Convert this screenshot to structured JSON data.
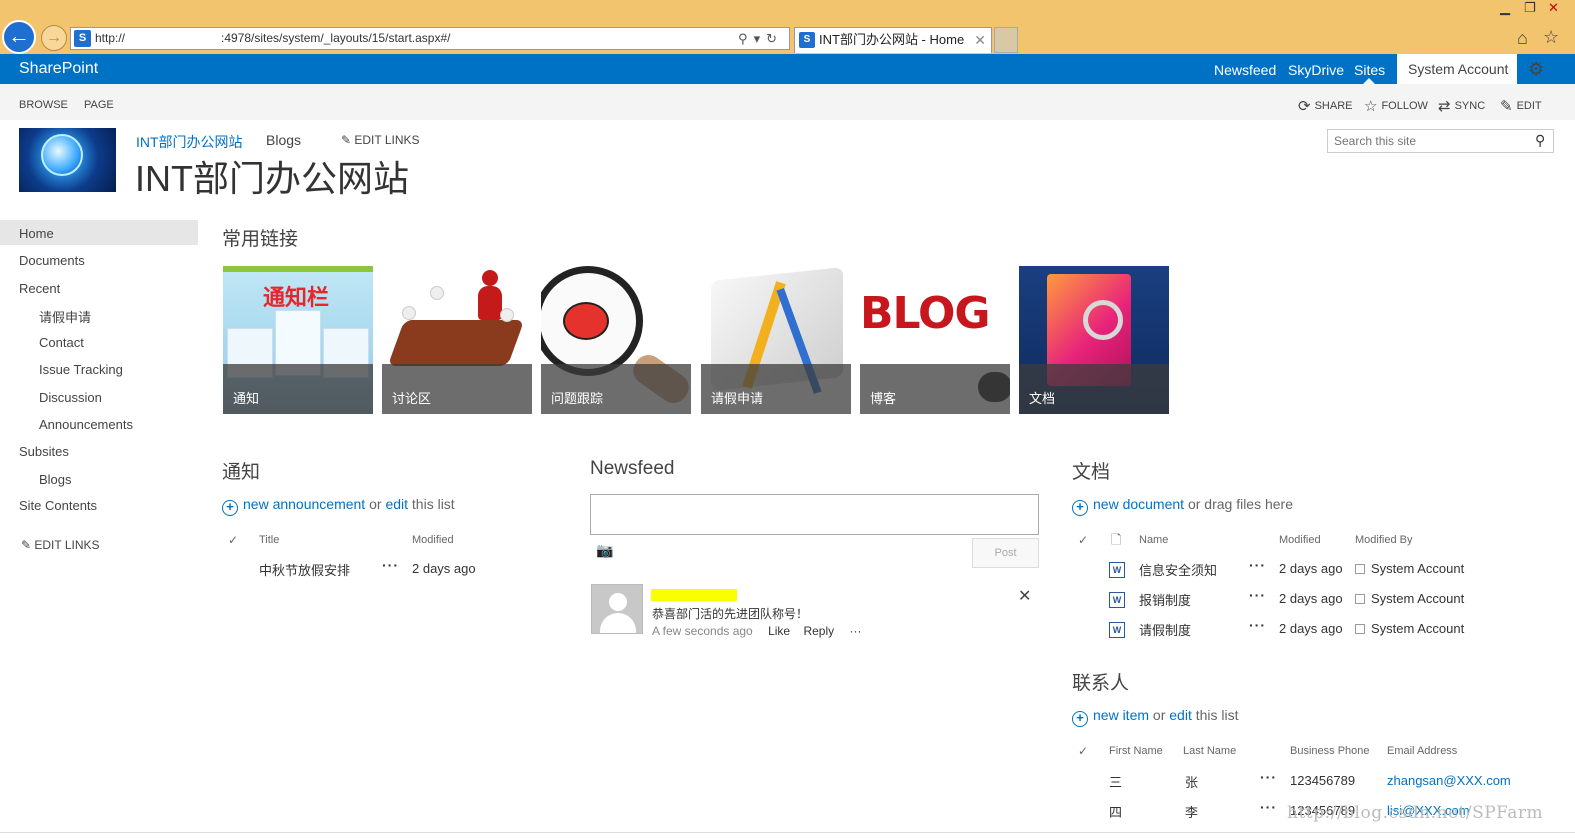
{
  "browser": {
    "url": "http://        :4978/sites/system/_layouts/15/start.aspx#/",
    "tab_title": "INT部门办公网站 - Home",
    "ie_badge": "S",
    "tab_close": "✕",
    "window_controls": [
      "▁",
      "❐",
      "✕"
    ]
  },
  "suite": {
    "brand": "SharePoint",
    "links": [
      "Newsfeed",
      "SkyDrive",
      "Sites"
    ],
    "account": "System Account ▾",
    "accent": "#0072c6"
  },
  "ribbon": {
    "tabs": [
      "BROWSE",
      "PAGE"
    ],
    "actions": [
      "SHARE",
      "FOLLOW",
      "SYNC",
      "EDIT"
    ]
  },
  "header": {
    "top_links": [
      "INT部门办公网站",
      "Blogs"
    ],
    "edit_links": "EDIT LINKS",
    "site_title": "INT部门办公网站",
    "search_placeholder": "Search this site"
  },
  "leftnav": {
    "items": [
      "Home",
      "Documents",
      "Recent",
      "请假申请",
      "Contact",
      "Issue Tracking",
      "Discussion",
      "Announcements",
      "Subsites",
      "Blogs",
      "Site Contents"
    ],
    "edit_links": "EDIT LINKS"
  },
  "quicklinks": {
    "title": "常用链接",
    "tiles": [
      "通知",
      "讨论区",
      "问题跟踪",
      "请假申请",
      "博客",
      "文档"
    ],
    "tile1_banner": "通知栏",
    "tile5_text": "BLOG"
  },
  "announcements": {
    "title": "通知",
    "add_prefix": "new announcement",
    "add_or": "or",
    "add_edit": "edit",
    "add_suffix": "this list",
    "columns": [
      "Title",
      "Modified"
    ],
    "rows": [
      {
        "title": "中秋节放假安排",
        "modified": "2 days ago"
      }
    ]
  },
  "newsfeed": {
    "title": "Newsfeed",
    "post_button": "Post",
    "post_text": "恭喜部门活的先进团队称号！",
    "post_time": "A few seconds ago",
    "like": "Like",
    "reply": "Reply",
    "more": "···"
  },
  "documents": {
    "title": "文档",
    "add_prefix": "new document",
    "add_suffix": "or drag files here",
    "columns": [
      "Name",
      "Modified",
      "Modified By"
    ],
    "rows": [
      {
        "name": "信息安全须知",
        "modified": "2 days ago",
        "by": "System Account"
      },
      {
        "name": "报销制度",
        "modified": "2 days ago",
        "by": "System Account"
      },
      {
        "name": "请假制度",
        "modified": "2 days ago",
        "by": "System Account"
      }
    ]
  },
  "contacts": {
    "title": "联系人",
    "add_prefix": "new item",
    "add_or": "or",
    "add_edit": "edit",
    "add_suffix": "this list",
    "columns": [
      "First Name",
      "Last Name",
      "Business Phone",
      "Email Address"
    ],
    "rows": [
      {
        "first": "三",
        "last": "张",
        "phone": "123456789",
        "email": "zhangsan@XXX.com"
      },
      {
        "first": "四",
        "last": "李",
        "phone": "123456789",
        "email": "lisi@XXX.com"
      }
    ]
  },
  "watermark": "http://blog.csdn.net/SPFarm"
}
